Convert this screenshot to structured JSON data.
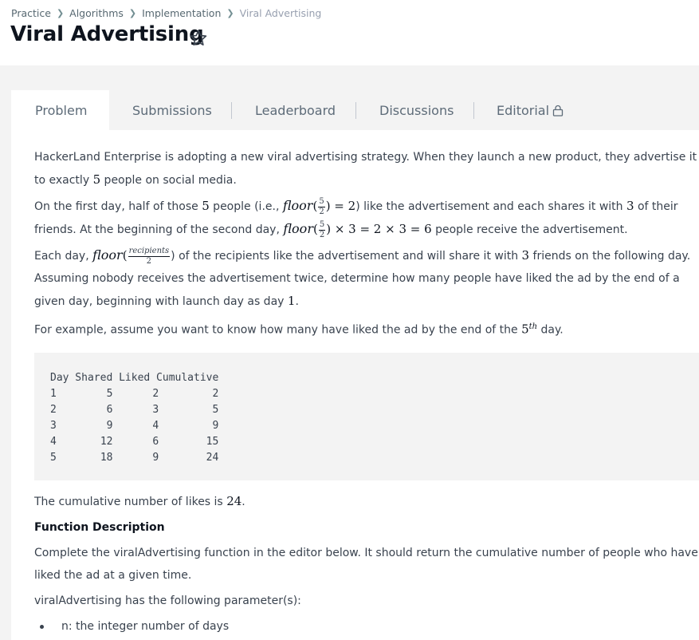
{
  "breadcrumb": {
    "items": [
      "Practice",
      "Algorithms",
      "Implementation"
    ],
    "current": "Viral Advertising"
  },
  "page": {
    "title": "Viral Advertising"
  },
  "tabs": [
    {
      "label": "Problem",
      "active": true
    },
    {
      "label": "Submissions"
    },
    {
      "label": "Leaderboard"
    },
    {
      "label": "Discussions"
    },
    {
      "label": "Editorial"
    }
  ],
  "problem": {
    "p1a": "HackerLand Enterprise is adopting a new viral advertising strategy. When they launch a new product, they advertise it to exactly ",
    "p1n": "5",
    "p1b": " people on social media.",
    "p2a": "On the first day, half of those ",
    "p2n": "5",
    "p2b": " people (i.e., ",
    "p2math": "floor",
    "p2num": "5",
    "p2den": "2",
    "p2eq": ") = 2",
    "p2c": ") like the advertisement and each shares it with ",
    "p2three": "3",
    "p2d": " of their friends. At the beginning of the second day, ",
    "p2math2": "floor",
    "p2num2": "5",
    "p2den2": "2",
    "p2eq2": ") × 3 = 2 × 3 = 6",
    "p2e": " people receive the advertisement.",
    "p3a": "Each day, ",
    "p3math": "floor",
    "p3num": "recipients",
    "p3den": "2",
    "p3b": ") of the recipients like the advertisement and will share it with ",
    "p3three": "3",
    "p3c": " friends on the following day. Assuming nobody receives the advertisement twice, determine how many people have liked the ad by the end of a given day, beginning with launch day as day ",
    "p3one": "1",
    "p3d": ".",
    "p4a": "For example, assume you want to know how many have liked the ad by the end of the ",
    "p4n": "5",
    "p4sup": "th",
    "p4b": " day.",
    "table_header": "Day Shared Liked Cumulative",
    "table_rows": [
      [
        "1",
        "5",
        "2",
        "2"
      ],
      [
        "2",
        "6",
        "3",
        "5"
      ],
      [
        "3",
        "9",
        "4",
        "9"
      ],
      [
        "4",
        "12",
        "6",
        "15"
      ],
      [
        "5",
        "18",
        "9",
        "24"
      ]
    ],
    "p5a": "The cumulative number of likes is ",
    "p5n": "24",
    "p5b": ".",
    "fd_title": "Function Description",
    "fd_text": "Complete the viralAdvertising function in the editor below. It should return the cumulative number of people who have liked the ad at a given time.",
    "params_intro": "viralAdvertising has the following parameter(s):",
    "params": [
      "n: the integer number of days"
    ]
  },
  "icons": {
    "star": "star-outline-icon",
    "lock": "lock-icon",
    "chevron": "chevron-right-icon"
  },
  "colors": {
    "text": "#39424e",
    "title": "#0e141e",
    "band": "#f3f3f3"
  }
}
